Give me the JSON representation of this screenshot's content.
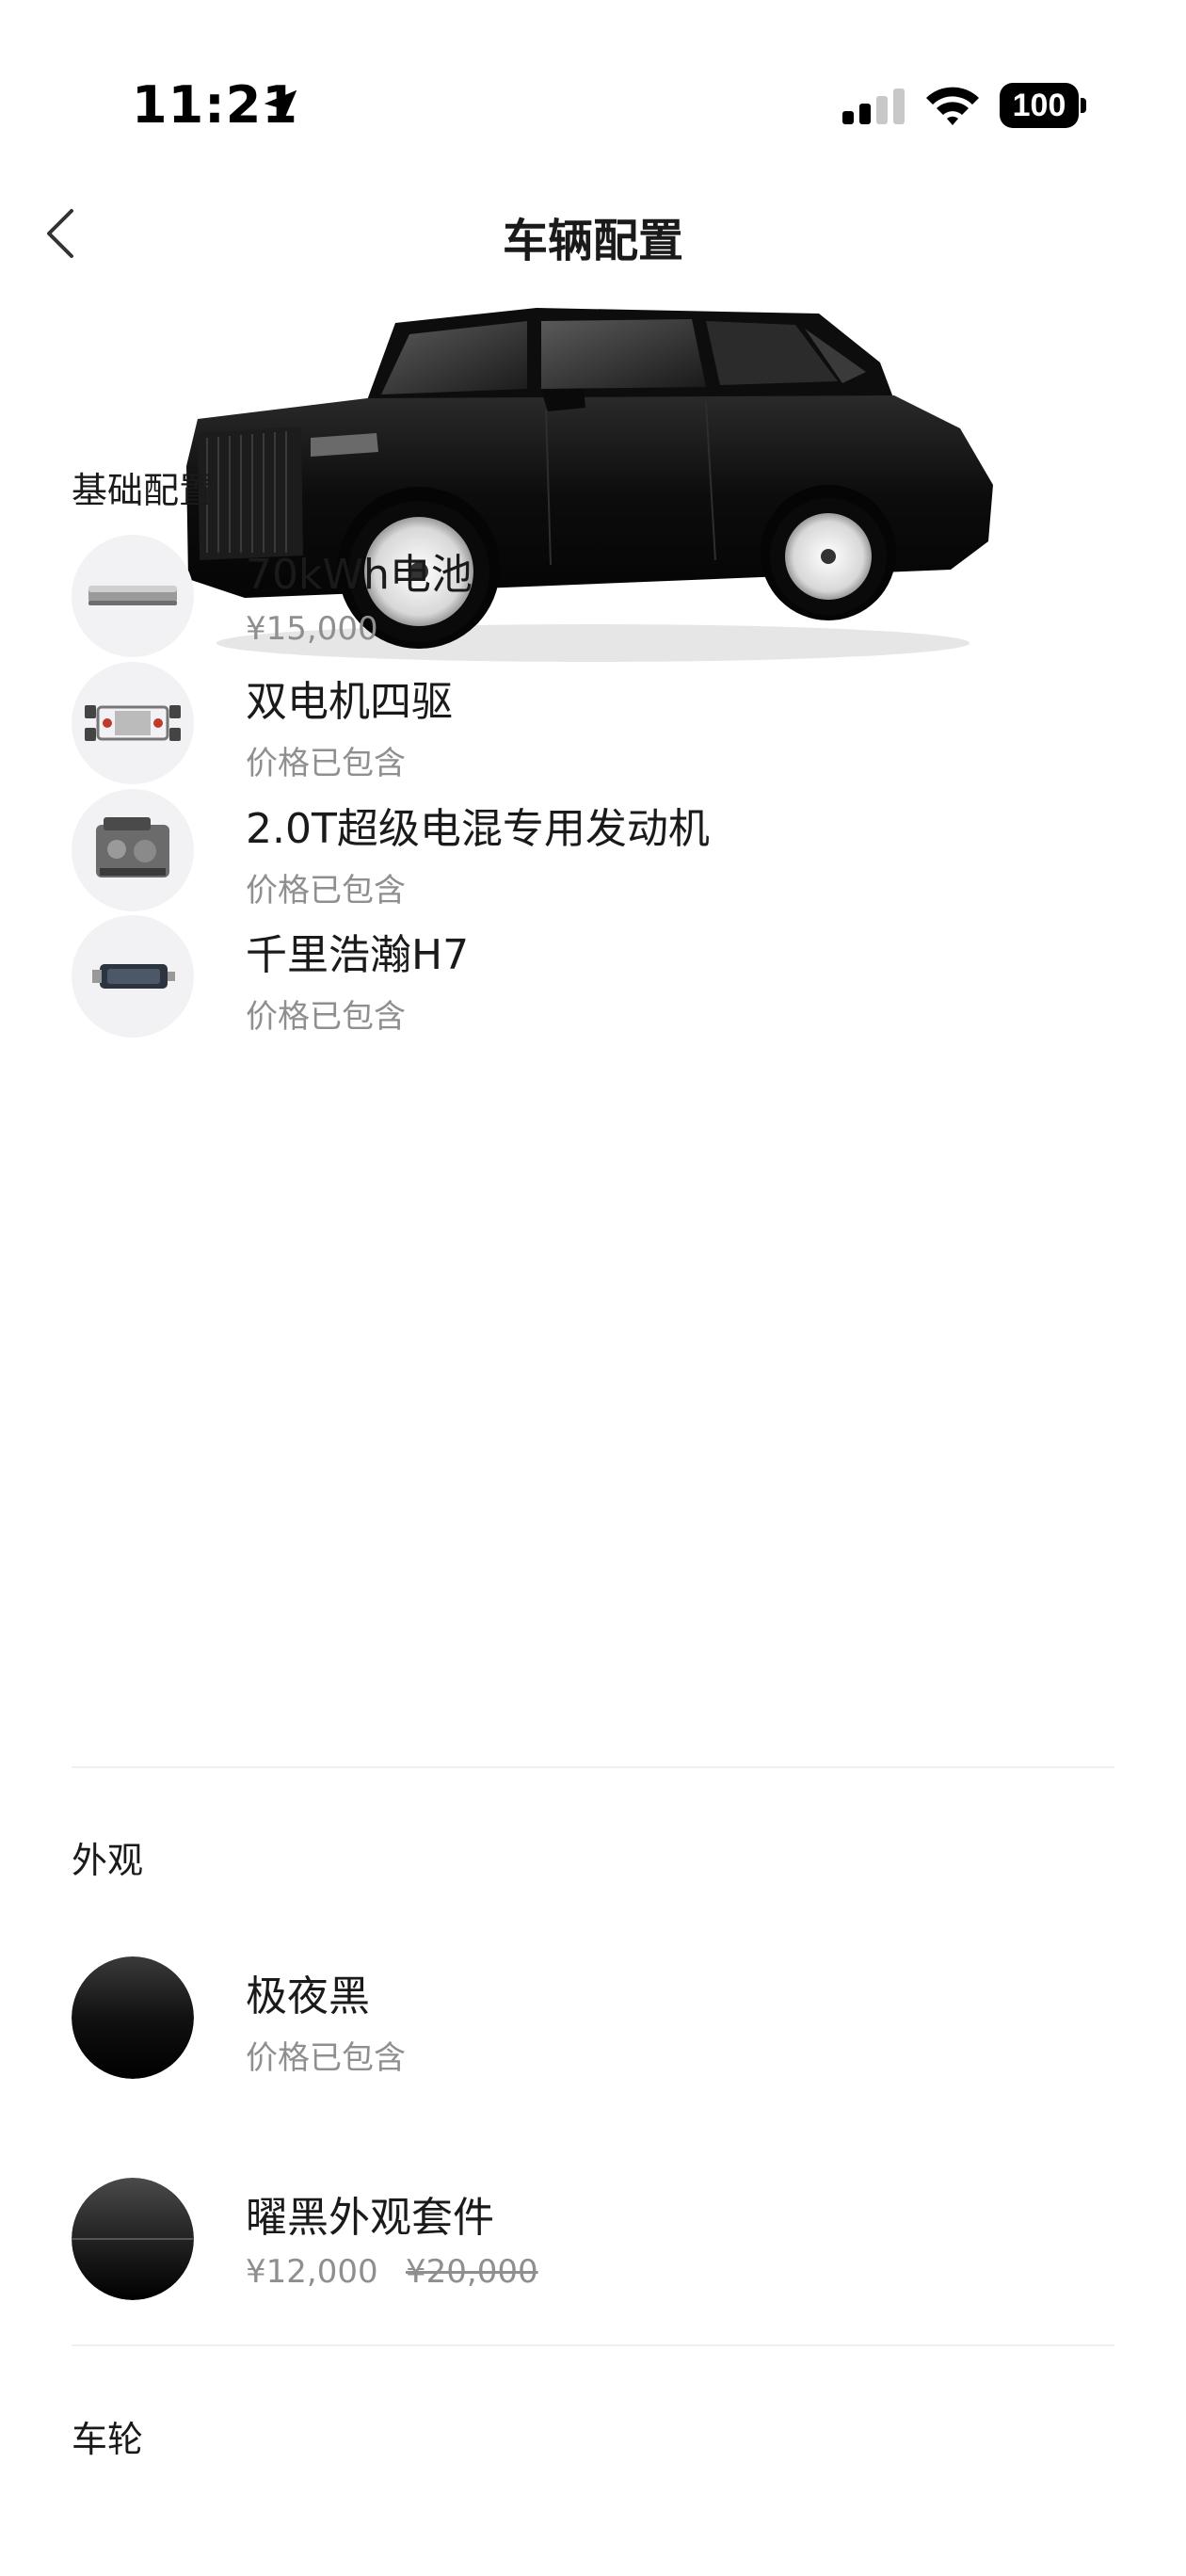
{
  "status_bar": {
    "time": "11:21",
    "battery": "100"
  },
  "header": {
    "title": "车辆配置"
  },
  "sections": [
    {
      "title": "基础配置",
      "items": [
        {
          "name": "70kWh电池",
          "price": "¥15,000"
        },
        {
          "name": "双电机四驱",
          "price": "价格已包含"
        },
        {
          "name": "2.0T超级电混专用发动机",
          "price": "价格已包含"
        },
        {
          "name": "千里浩瀚H7",
          "price": "价格已包含"
        }
      ]
    },
    {
      "title": "外观",
      "items": [
        {
          "name": "极夜黑",
          "price": "价格已包含"
        },
        {
          "name": "曜黑外观套件",
          "price": "¥12,000",
          "original_price": "¥20,000"
        }
      ]
    },
    {
      "title": "车轮",
      "items": []
    }
  ],
  "colors": {
    "text_primary": "#1a1a1a",
    "text_secondary": "#8f8f8f",
    "divider": "#f0f0f0",
    "thumb_bg": "#f2f2f4"
  }
}
